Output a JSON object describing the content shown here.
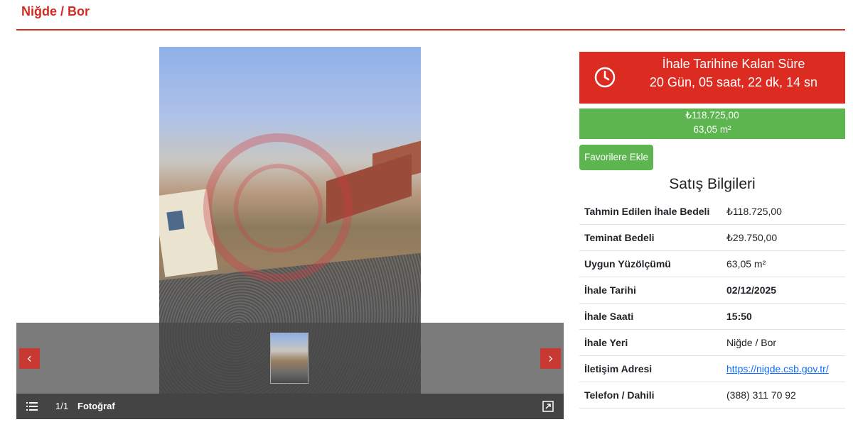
{
  "header": {
    "location": "Niğde / Bor"
  },
  "gallery": {
    "counter": "1/1",
    "media_label": "Fotoğraf",
    "prev_label": "‹",
    "next_label": "›"
  },
  "countdown": {
    "title": "İhale Tarihine Kalan Süre",
    "value": "20 Gün, 05 saat, 22 dk, 14 sn"
  },
  "price": {
    "amount": "₺118.725,00",
    "area": "63,05 m²"
  },
  "favorites_button": "Favorilere Ekle",
  "sales_info": {
    "title": "Satış Bilgileri",
    "rows": [
      {
        "label": "Tahmin Edilen İhale Bedeli",
        "value": "₺118.725,00"
      },
      {
        "label": "Teminat Bedeli",
        "value": "₺29.750,00"
      },
      {
        "label": "Uygun Yüzölçümü",
        "value": "63,05 m²"
      },
      {
        "label": "İhale Tarihi",
        "value": "02/12/2025"
      },
      {
        "label": "İhale Saati",
        "value": "15:50"
      },
      {
        "label": "İhale Yeri",
        "value": "Niğde / Bor"
      },
      {
        "label": "İletişim Adresi",
        "value": "https://nigde.csb.gov.tr/"
      },
      {
        "label": "Telefon / Dahili",
        "value": "(388) 311 70 92"
      }
    ]
  },
  "colors": {
    "accent_red": "#dc2b21",
    "accent_green": "#5cb54f",
    "link": "#0d6efd"
  }
}
